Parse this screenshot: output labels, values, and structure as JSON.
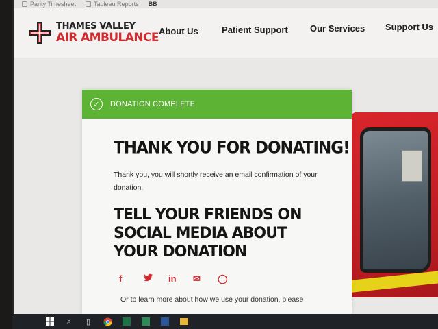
{
  "bookmarks": [
    {
      "label": "Parity Timesheet"
    },
    {
      "label": "Tableau Reports"
    },
    {
      "label": "BB"
    }
  ],
  "logo": {
    "line1": "THAMES VALLEY",
    "line2": "AIR AMBULANCE"
  },
  "nav": {
    "items": [
      {
        "label": "About Us"
      },
      {
        "label": "Patient Support"
      },
      {
        "label": "Our Services"
      },
      {
        "label": "Support Us"
      }
    ]
  },
  "banner": {
    "text": "DONATION COMPLETE",
    "color": "#5db333"
  },
  "content": {
    "heading": "THANK YOU FOR DONATING!",
    "message": "Thank you, you will shortly receive an email confirmation of your donation.",
    "share_heading": "TELL YOUR FRIENDS ON SOCIAL MEDIA ABOUT YOUR DONATION",
    "social": [
      {
        "name": "facebook-icon",
        "glyph": "f"
      },
      {
        "name": "twitter-icon",
        "glyph": "🐦"
      },
      {
        "name": "linkedin-icon",
        "glyph": "in"
      },
      {
        "name": "email-icon",
        "glyph": "✉"
      },
      {
        "name": "whatsapp-icon",
        "glyph": "◯"
      }
    ],
    "more_text": "Or to learn more about how we use your donation, please"
  },
  "colors": {
    "brand_red": "#d12a2f",
    "success_green": "#5db333"
  }
}
